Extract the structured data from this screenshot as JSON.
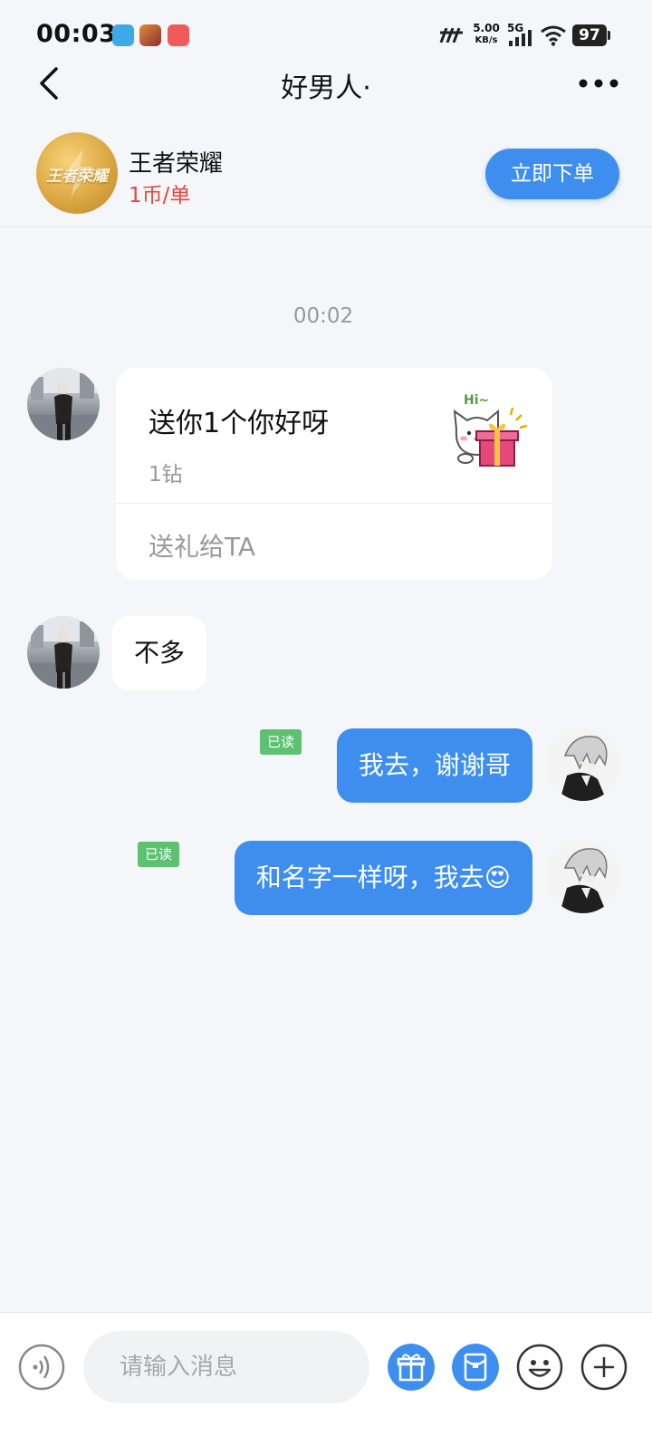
{
  "status_bar": {
    "time": "00:03",
    "net_speed": "5.00",
    "net_unit": "KB/s",
    "network": "5G",
    "battery": "97"
  },
  "header": {
    "title": "好男人·"
  },
  "service": {
    "name": "王者荣耀",
    "price": "1币/单",
    "order_label": "立即下单",
    "logo_text": "王者荣耀"
  },
  "chat": {
    "time": "00:02",
    "gift": {
      "title": "送你1个你好呀",
      "cost": "1钻",
      "action": "送礼给TA",
      "sticker_text": "Hi~"
    },
    "messages": [
      {
        "side": "left",
        "text": "不多"
      },
      {
        "side": "right",
        "text": "我去，谢谢哥",
        "status": "已读"
      },
      {
        "side": "right",
        "text": "和名字一样呀，我去😍",
        "status": "已读"
      }
    ]
  },
  "input": {
    "placeholder": "请输入消息"
  },
  "colors": {
    "accent": "#3d8eef",
    "price": "#e0483e",
    "read_badge": "#5cc171",
    "background": "#f4f6f9"
  },
  "icons": [
    "voice-icon",
    "gift-icon",
    "red-packet-icon",
    "emoji-icon",
    "plus-icon",
    "back-arrow-icon",
    "more-dots-icon"
  ]
}
